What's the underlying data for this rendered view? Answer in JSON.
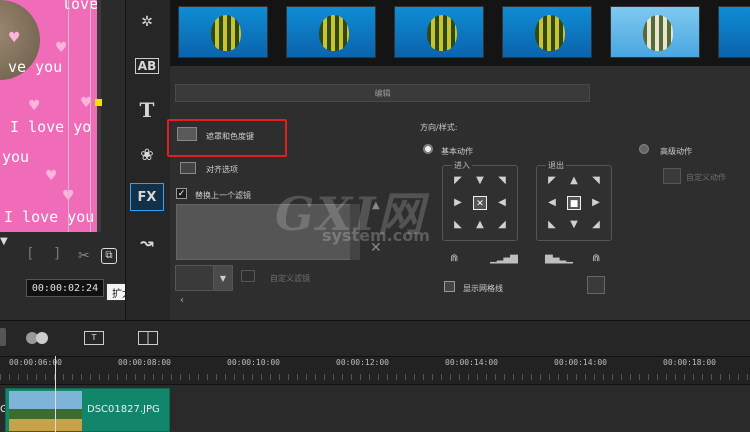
{
  "preview": {
    "text_lines": [
      "love",
      "ve you",
      "I love yo",
      "you",
      "I love you"
    ]
  },
  "tools": {
    "fx_label": "FX",
    "ab_label": "AB",
    "title_label": "T"
  },
  "options": {
    "edit_tab": "编辑",
    "mask_chroma_label": "遮罩和色度键",
    "align_options_label": "对齐选项",
    "replace_filter_label": "替换上一个滤镜",
    "custom_filter_label": "自定义滤镜",
    "direction_style_label": "方向/样式:",
    "basic_motion_label": "基本动作",
    "advanced_motion_label": "高级动作",
    "enter_label": "进入",
    "exit_label": "退出",
    "show_grid_label": "显示网格线",
    "custom_motion_label": "自定义动作"
  },
  "playback": {
    "timecode": "00:00:02:24",
    "tooltip": "扩大"
  },
  "ruler": {
    "ticks": [
      "00:00:06:00",
      "00:00:08:00",
      "00:00:10:00",
      "00:00:12:00",
      "00:00:14:00",
      "00:00:14:00",
      "00:00:18:00"
    ]
  },
  "timeline": {
    "clip_name": "DSC01827.JPG",
    "clip_prefix": "G"
  },
  "watermark": {
    "text": "GXI网",
    "domain": "system.com"
  },
  "colors": {
    "preview_bg": "#f06cb8",
    "highlight_box": "#e02020",
    "fx_active": "#2ea0ff",
    "clip": "#12866a"
  }
}
